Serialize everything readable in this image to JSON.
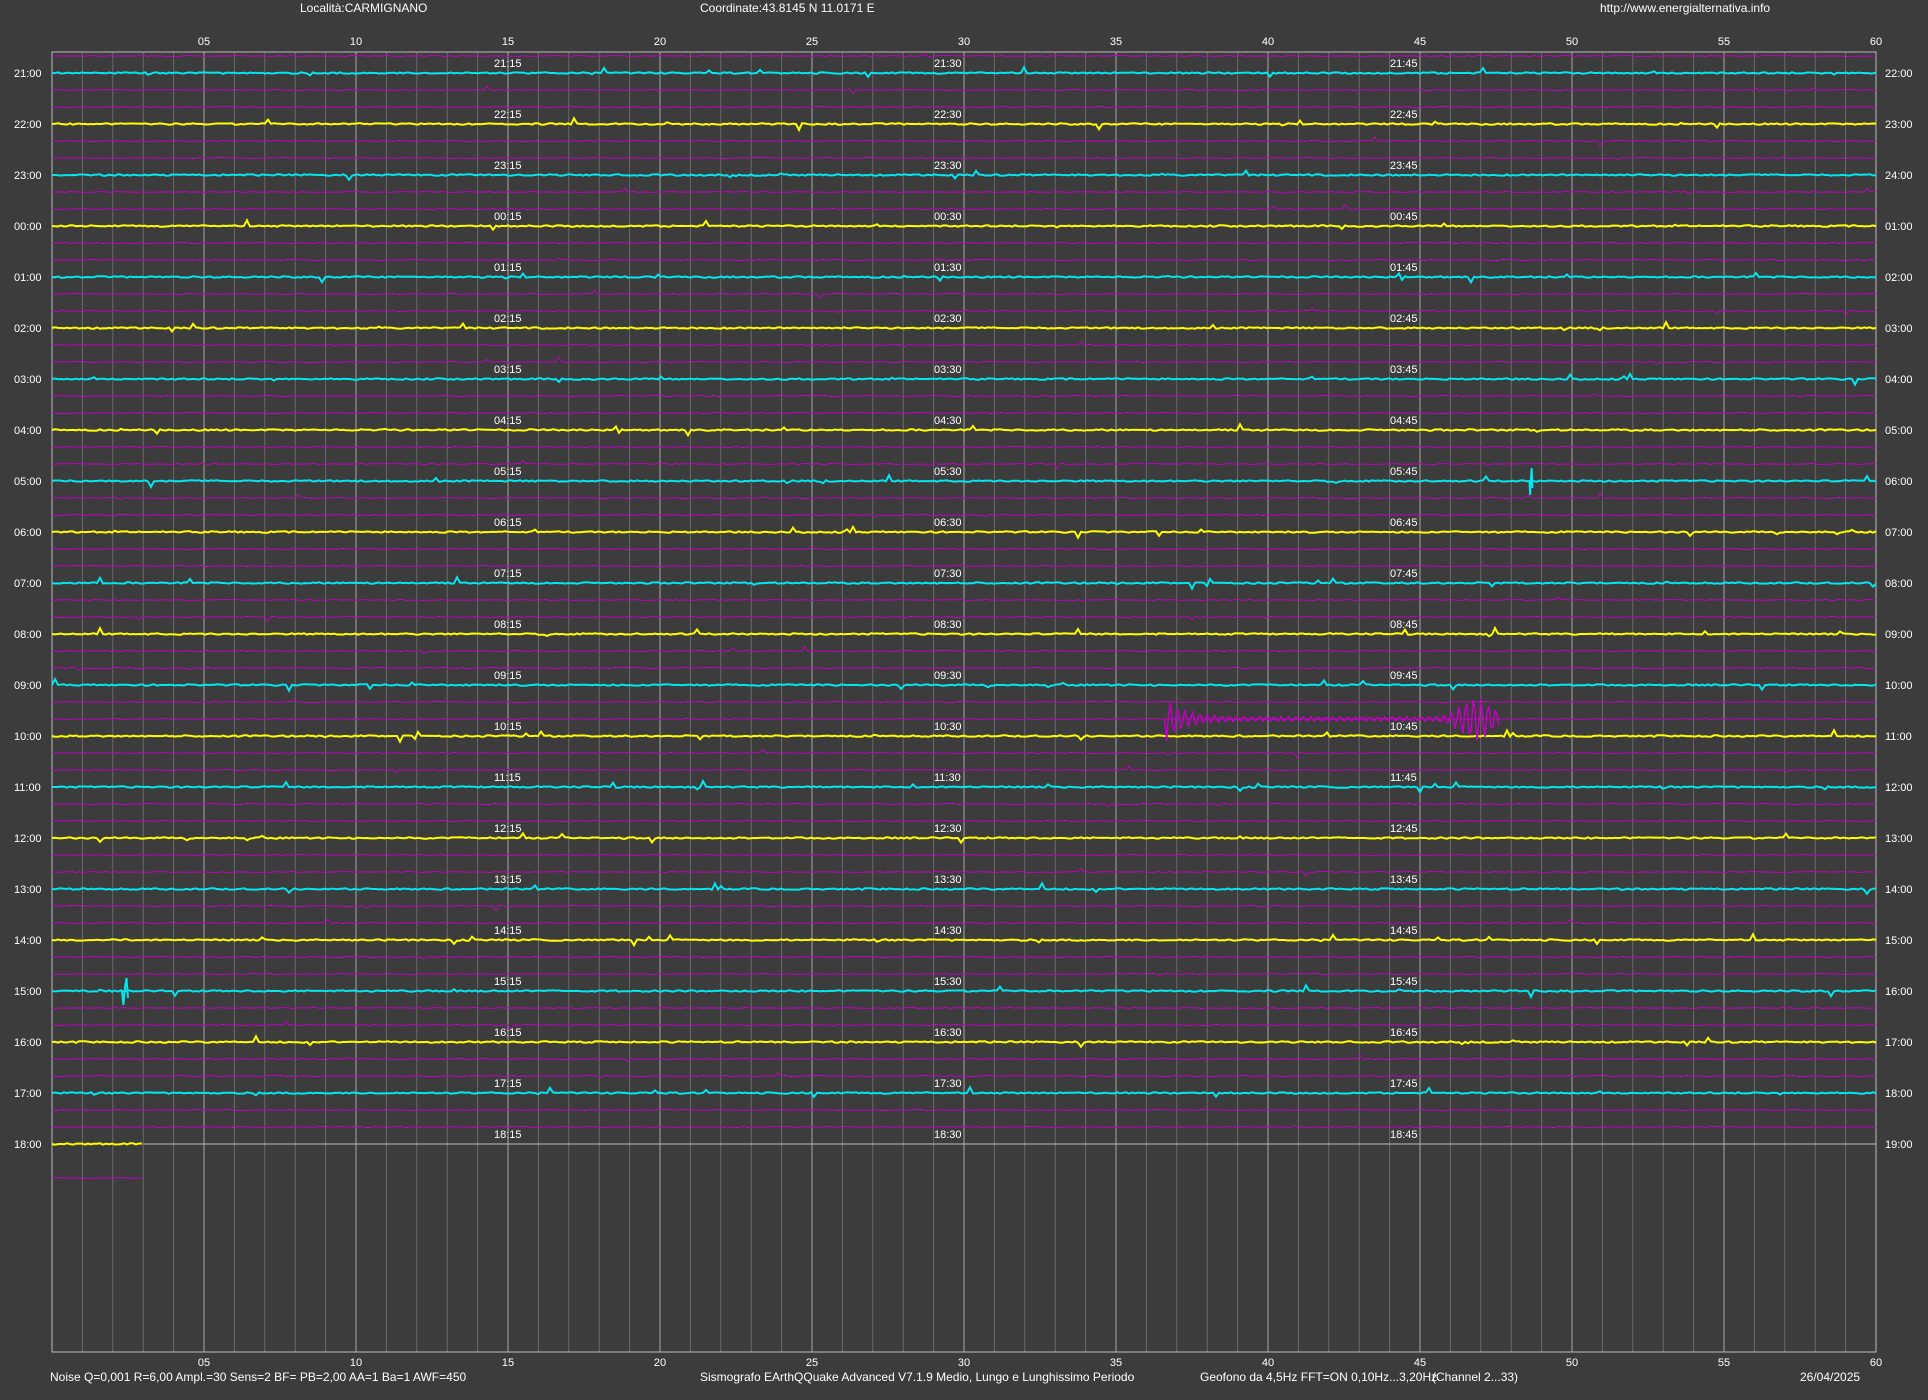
{
  "header": {
    "location": "Località:CARMIGNANO",
    "coordinates": "Coordinate:43.8145 N 11.0171 E",
    "website": "http://www.energialternativa.info"
  },
  "footer": {
    "parameters": "Noise Q=0,001 R=6,00 Ampl.=30 Sens=2 BF= PB=2,00 AA=1 Ba=1 AWF=450",
    "software": "Sismografo  EArthQQuake Advanced V7.1.9  Medio, Lungo e Lunghissimo Periodo",
    "geophone": "Geofono da 4,5Hz FFT=ON 0,10Hz...3,20Hz",
    "channel": "(Channel 2...33)",
    "date": "26/04/2025"
  },
  "colors": {
    "background": "#3c3c3c",
    "trace_cyan": "#00e5ee",
    "trace_yellow": "#ffff00",
    "trace_magenta": "#c000c0",
    "grid": "#bdbdbd",
    "text": "#ffffff"
  },
  "chart_data": {
    "type": "line",
    "x_axis": {
      "min": 0,
      "max": 60,
      "unit": "minutes",
      "tick_labels": [
        "05",
        "10",
        "15",
        "20",
        "25",
        "30",
        "35",
        "40",
        "45",
        "50",
        "55",
        "60"
      ],
      "minor_step": 1
    },
    "rows": [
      {
        "left": "21:00",
        "right": "22:00",
        "q15": "21:15",
        "q30": "21:30",
        "q45": "21:45",
        "color": "cyan"
      },
      {
        "left": "22:00",
        "right": "23:00",
        "q15": "22:15",
        "q30": "22:30",
        "q45": "22:45",
        "color": "yellow"
      },
      {
        "left": "23:00",
        "right": "24:00",
        "q15": "23:15",
        "q30": "23:30",
        "q45": "23:45",
        "color": "cyan"
      },
      {
        "left": "00:00",
        "right": "01:00",
        "q15": "00:15",
        "q30": "00:30",
        "q45": "00:45",
        "color": "yellow"
      },
      {
        "left": "01:00",
        "right": "02:00",
        "q15": "01:15",
        "q30": "01:30",
        "q45": "01:45",
        "color": "cyan"
      },
      {
        "left": "02:00",
        "right": "03:00",
        "q15": "02:15",
        "q30": "02:30",
        "q45": "02:45",
        "color": "yellow"
      },
      {
        "left": "03:00",
        "right": "04:00",
        "q15": "03:15",
        "q30": "03:30",
        "q45": "03:45",
        "color": "cyan"
      },
      {
        "left": "04:00",
        "right": "05:00",
        "q15": "04:15",
        "q30": "04:30",
        "q45": "04:45",
        "color": "yellow"
      },
      {
        "left": "05:00",
        "right": "06:00",
        "q15": "05:15",
        "q30": "05:30",
        "q45": "05:45",
        "color": "cyan"
      },
      {
        "left": "06:00",
        "right": "07:00",
        "q15": "06:15",
        "q30": "06:30",
        "q45": "06:45",
        "color": "yellow"
      },
      {
        "left": "07:00",
        "right": "08:00",
        "q15": "07:15",
        "q30": "07:30",
        "q45": "07:45",
        "color": "cyan"
      },
      {
        "left": "08:00",
        "right": "09:00",
        "q15": "08:15",
        "q30": "08:30",
        "q45": "08:45",
        "color": "yellow"
      },
      {
        "left": "09:00",
        "right": "10:00",
        "q15": "09:15",
        "q30": "09:30",
        "q45": "09:45",
        "color": "cyan"
      },
      {
        "left": "10:00",
        "right": "11:00",
        "q15": "10:15",
        "q30": "10:30",
        "q45": "10:45",
        "color": "yellow"
      },
      {
        "left": "11:00",
        "right": "12:00",
        "q15": "11:15",
        "q30": "11:30",
        "q45": "11:45",
        "color": "cyan"
      },
      {
        "left": "12:00",
        "right": "13:00",
        "q15": "12:15",
        "q30": "12:30",
        "q45": "12:45",
        "color": "yellow"
      },
      {
        "left": "13:00",
        "right": "14:00",
        "q15": "13:15",
        "q30": "13:30",
        "q45": "13:45",
        "color": "cyan"
      },
      {
        "left": "14:00",
        "right": "15:00",
        "q15": "14:15",
        "q30": "14:30",
        "q45": "14:45",
        "color": "yellow"
      },
      {
        "left": "15:00",
        "right": "16:00",
        "q15": "15:15",
        "q30": "15:30",
        "q45": "15:45",
        "color": "cyan"
      },
      {
        "left": "16:00",
        "right": "17:00",
        "q15": "16:15",
        "q30": "16:30",
        "q45": "16:45",
        "color": "yellow"
      },
      {
        "left": "17:00",
        "right": "18:00",
        "q15": "17:15",
        "q30": "17:30",
        "q45": "17:45",
        "color": "cyan"
      },
      {
        "left": "18:00",
        "right": "19:00",
        "q15": "18:15",
        "q30": "18:30",
        "q45": "18:45",
        "color": "yellow",
        "recorded_until_minute": 3
      }
    ],
    "events": [
      {
        "row": 13,
        "start_minute": 36.6,
        "end_minute": 47.6,
        "color": "magenta",
        "note": ""
      },
      {
        "row": 18,
        "start_minute": 2.3,
        "end_minute": 2.5,
        "color": "cyan",
        "note": ""
      },
      {
        "row": 8,
        "start_minute": 48.6,
        "end_minute": 48.7,
        "color": "cyan",
        "note": ""
      }
    ]
  }
}
